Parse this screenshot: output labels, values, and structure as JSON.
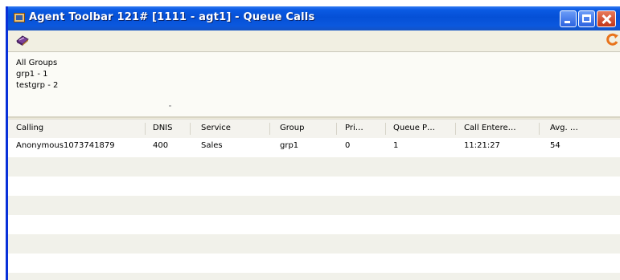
{
  "window": {
    "title": "Agent Toolbar 121# [1111 - agt1] - Queue Calls",
    "title_bar_color": "#0a5ae3",
    "buttons": {
      "minimize": "minimize",
      "maximize": "maximize",
      "close": "close"
    }
  },
  "toolbar": {
    "left_icon": "book-icon",
    "right_icon": "refresh-icon"
  },
  "groups": {
    "items": [
      {
        "label": "All Groups"
      },
      {
        "label": "grp1 - 1"
      },
      {
        "label": "testgrp - 2"
      }
    ]
  },
  "table": {
    "columns": [
      "Calling",
      "DNIS",
      "Service",
      "Group",
      "Pri…",
      "Queue P…",
      "Call Entere…",
      "Avg. …"
    ],
    "rows": [
      [
        "Anonymous1073741879",
        "400",
        "Sales",
        "grp1",
        "0",
        "1",
        "11:21:27",
        "54"
      ]
    ],
    "stripe_color": "#f1f1ea"
  }
}
